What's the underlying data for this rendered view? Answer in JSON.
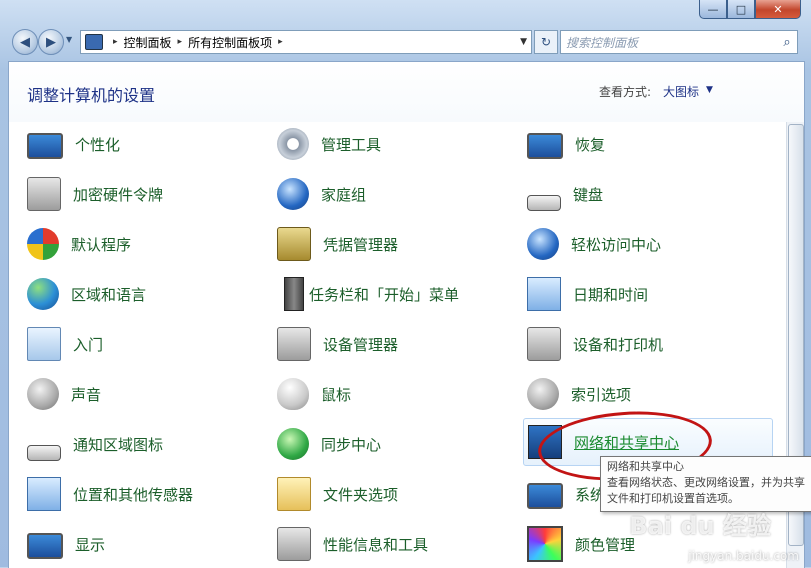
{
  "window": {
    "controls": {
      "minimize": "—",
      "maximize": "□",
      "close": "✕"
    }
  },
  "toolbar": {
    "back_icon": "◀",
    "forward_icon": "▶",
    "recent_icon": "▼",
    "breadcrumb": [
      "控制面板",
      "所有控制面板项"
    ],
    "breadcrumb_sep": "▸",
    "address_drop": "▼",
    "refresh_icon": "↻",
    "search_placeholder": "搜索控制面板",
    "search_icon": "⌕"
  },
  "header": {
    "title": "调整计算机的设置",
    "view_by_label": "查看方式:",
    "view_by_value": "大图标",
    "view_arrow": "▼"
  },
  "items": [
    [
      {
        "label": "个性化",
        "icon": "monitor-icon"
      },
      {
        "label": "管理工具",
        "icon": "gear-icon"
      },
      {
        "label": "恢复",
        "icon": "monitor-icon"
      }
    ],
    [
      {
        "label": "加密硬件令牌",
        "icon": "token-icon"
      },
      {
        "label": "家庭组",
        "icon": "homegroup-icon"
      },
      {
        "label": "键盘",
        "icon": "keyboard-icon"
      }
    ],
    [
      {
        "label": "默认程序",
        "icon": "default-programs-icon"
      },
      {
        "label": "凭据管理器",
        "icon": "safe-icon"
      },
      {
        "label": "轻松访问中心",
        "icon": "accessibility-icon"
      }
    ],
    [
      {
        "label": "区域和语言",
        "icon": "globe-icon"
      },
      {
        "label": "任务栏和「开始」菜单",
        "icon": "taskbar-icon"
      },
      {
        "label": "日期和时间",
        "icon": "calendar-icon"
      }
    ],
    [
      {
        "label": "入门",
        "icon": "document-icon"
      },
      {
        "label": "设备管理器",
        "icon": "device-manager-icon"
      },
      {
        "label": "设备和打印机",
        "icon": "printer-icon"
      }
    ],
    [
      {
        "label": "声音",
        "icon": "speaker-icon"
      },
      {
        "label": "鼠标",
        "icon": "mouse-icon"
      },
      {
        "label": "索引选项",
        "icon": "index-icon"
      }
    ],
    [
      {
        "label": "通知区域图标",
        "icon": "notification-icon"
      },
      {
        "label": "同步中心",
        "icon": "sync-icon"
      },
      {
        "label": "网络和共享中心",
        "icon": "network-icon"
      }
    ],
    [
      {
        "label": "位置和其他传感器",
        "icon": "sensor-icon"
      },
      {
        "label": "文件夹选项",
        "icon": "folder-icon"
      },
      {
        "label": "系统",
        "icon": "system-icon"
      }
    ],
    [
      {
        "label": "显示",
        "icon": "display-icon"
      },
      {
        "label": "性能信息和工具",
        "icon": "performance-icon"
      },
      {
        "label": "颜色管理",
        "icon": "color-icon"
      }
    ]
  ],
  "tooltip": {
    "title": "网络和共享中心",
    "text": "查看网络状态、更改网络设置，并为共享文件和打印机设置首选项。"
  },
  "watermark": {
    "logo": "Bai du 经验",
    "url": "jingyan.baidu.com"
  },
  "colors": {
    "link_green": "#1b5e2a",
    "title_blue": "#1e3287",
    "annotation_red": "#c21414"
  }
}
